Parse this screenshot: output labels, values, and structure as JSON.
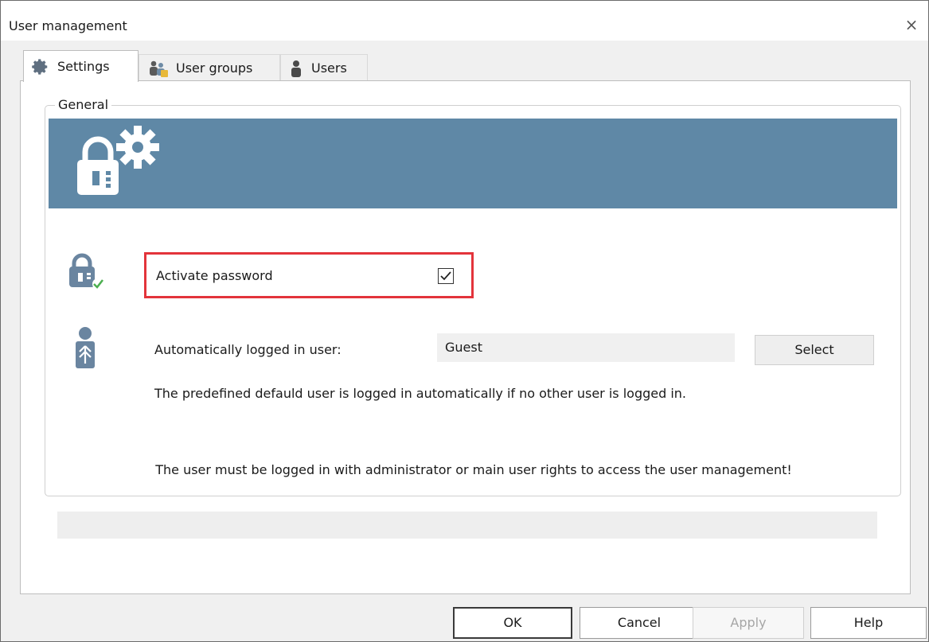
{
  "window": {
    "title": "User management",
    "close_glyph": "×"
  },
  "tabs": [
    {
      "label": "Settings",
      "icon": "gear-icon",
      "active": true
    },
    {
      "label": "User groups",
      "icon": "user-group-icon",
      "active": false
    },
    {
      "label": "Users",
      "icon": "user-icon",
      "active": false
    }
  ],
  "general": {
    "legend": "General",
    "banner_color": "#5f88a6",
    "activate_password": {
      "label": "Activate password",
      "checked": true,
      "highlight_color": "#e3343b"
    },
    "auto_login": {
      "label": "Automatically logged in user:",
      "value": "Guest",
      "select_label": "Select",
      "description": "The predefined defauld user is logged in automatically if no other user is logged in."
    },
    "admin_note": "The user must be logged in with administrator or main user rights to access the user management!"
  },
  "buttons": {
    "ok": "OK",
    "cancel": "Cancel",
    "apply": "Apply",
    "help": "Help"
  }
}
